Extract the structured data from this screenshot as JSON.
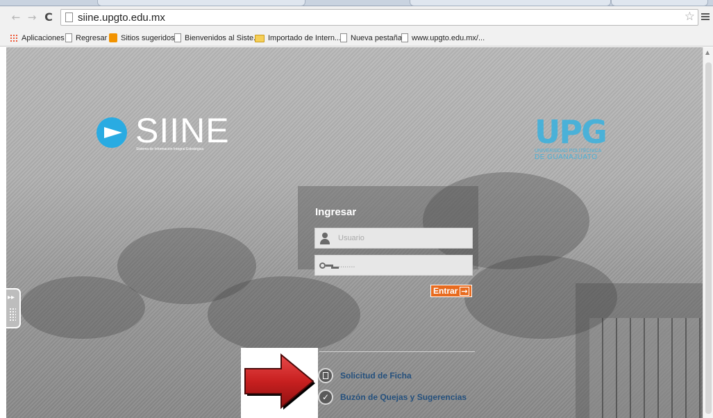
{
  "browser": {
    "url": "siine.upgto.edu.mx",
    "back_icon": "back-arrow-icon",
    "forward_icon": "forward-arrow-icon",
    "reload_icon": "reload-icon",
    "bookmark_icon": "star-icon",
    "menu_icon": "hamburger-menu-icon"
  },
  "bookmarks": [
    {
      "label": "Aplicaciones",
      "icon": "apps-grid-icon"
    },
    {
      "label": "Regresar",
      "icon": "page-icon"
    },
    {
      "label": "Sitios sugeridos",
      "icon": "suggested-sites-icon"
    },
    {
      "label": "Bienvenidos al Siste...",
      "icon": "page-icon"
    },
    {
      "label": "Importado de Intern...",
      "icon": "folder-icon"
    },
    {
      "label": "Nueva pestaña",
      "icon": "page-icon"
    },
    {
      "label": "www.upgto.edu.mx/...",
      "icon": "page-icon"
    }
  ],
  "logos": {
    "siine_word": "SIINE",
    "siine_subtitle": "Sistema de Información Integral Estratégica",
    "upg_word": "UPG",
    "upg_line1": "UNIVERSIDAD POLITÉCNICA",
    "upg_line2": "DE GUANAJUATO"
  },
  "login": {
    "title": "Ingresar",
    "username_placeholder": "Usuario",
    "password_value": "........",
    "submit_label": "Entrar"
  },
  "links": [
    {
      "label": "Solicitud de Ficha",
      "icon": "document-icon"
    },
    {
      "label": "Buzón de Quejas y Sugerencias",
      "icon": "checkmark-icon"
    }
  ],
  "annotation": {
    "icon": "red-arrow-icon",
    "color": "#cc2222"
  },
  "colors": {
    "accent_orange": "#e86b1f",
    "siine_blue": "#29abe2",
    "upg_blue": "#4ab1d8",
    "link_blue": "#24507d"
  }
}
